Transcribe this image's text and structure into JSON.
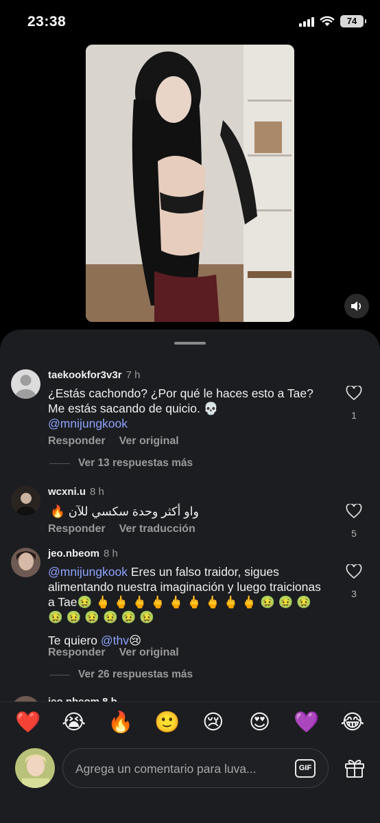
{
  "status_bar": {
    "time": "23:38",
    "battery": "74"
  },
  "comments": [
    {
      "username": "taekookfor3v3r",
      "time": "7 h",
      "text": "¿Estás cachondo? ¿Por qué le haces esto a Tae? Me estás sacando de quicio. 💀",
      "mention": "@mnijungkook",
      "reply_label": "Responder",
      "secondary_label": "Ver original",
      "likes": "1",
      "replies_label": "Ver 13 respuestas más"
    },
    {
      "username": "wcxni.u",
      "time": "8 h",
      "text": "واو أكثر وحدة سكسي للآن 🔥",
      "reply_label": "Responder",
      "secondary_label": "Ver traducción",
      "likes": "5"
    },
    {
      "username": "jeo.nbeom",
      "time": "8 h",
      "mention": "@mnijungkook",
      "text": " Eres un falso traidor, sigues alimentando nuestra imaginación y luego traicionas a Tae🤢 🖕 🖕 🖕 🖕 🖕 🖕 🖕 🖕 🖕 🤢 🤢 🤢 🤢 🤢 🤢 🤢 🤢 🤢",
      "line2_prefix": "Te quiero ",
      "line2_mention": "@thv",
      "line2_suffix": "😢",
      "reply_label": "Responder",
      "secondary_label": "Ver original",
      "likes": "3",
      "replies_label": "Ver 26 respuestas más"
    }
  ],
  "partial_username": "jeo.nbeom 8 h",
  "emojis": [
    "❤️",
    "😭",
    "🔥",
    "🙂",
    "😢",
    "😍",
    "💜",
    "😂"
  ],
  "input": {
    "placeholder": "Agrega un comentario para luva...",
    "gif_label": "GIF"
  }
}
